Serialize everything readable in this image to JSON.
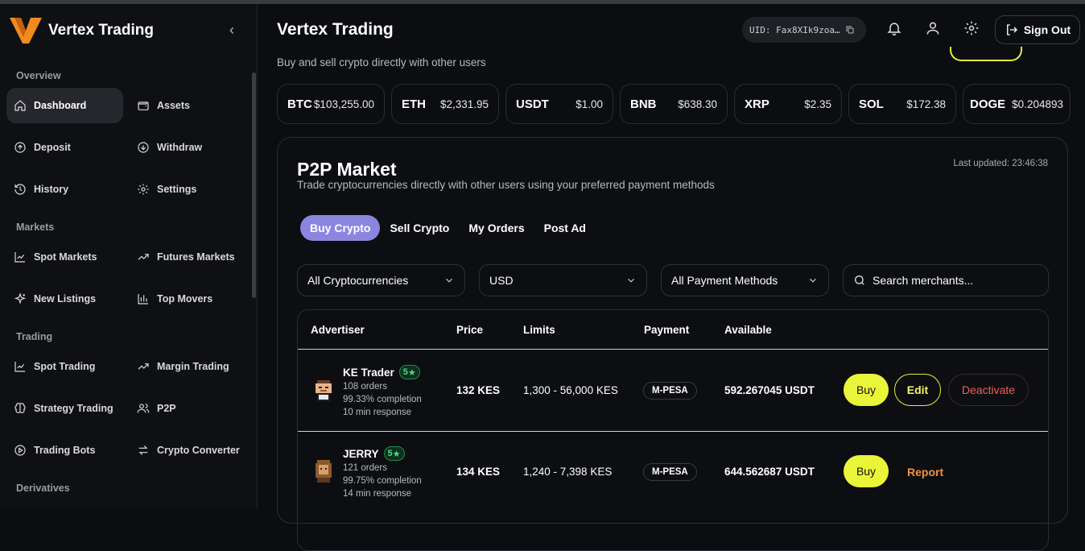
{
  "brand": {
    "name": "Vertex Trading",
    "accent": "#f28a1e"
  },
  "sidebar": {
    "sections": {
      "overview": "Overview",
      "markets": "Markets",
      "trading": "Trading",
      "derivatives": "Derivatives"
    },
    "items": {
      "dashboard": "Dashboard",
      "assets": "Assets",
      "deposit": "Deposit",
      "withdraw": "Withdraw",
      "history": "History",
      "settings": "Settings",
      "spot_markets": "Spot Markets",
      "futures_markets": "Futures Markets",
      "new_listings": "New Listings",
      "top_movers": "Top Movers",
      "spot_trading": "Spot Trading",
      "margin_trading": "Margin Trading",
      "strategy_trading": "Strategy Trading",
      "p2p": "P2P",
      "trading_bots": "Trading Bots",
      "crypto_converter": "Crypto Converter"
    }
  },
  "header": {
    "title": "Vertex Trading",
    "uid": "UID: Fax8XIk9zoa…",
    "sign_out": "Sign Out"
  },
  "main": {
    "subtitle": "Buy and sell crypto directly with other users",
    "tickers": [
      {
        "symbol": "BTC",
        "price": "$103,255.00"
      },
      {
        "symbol": "ETH",
        "price": "$2,331.95"
      },
      {
        "symbol": "USDT",
        "price": "$1.00"
      },
      {
        "symbol": "BNB",
        "price": "$638.30"
      },
      {
        "symbol": "XRP",
        "price": "$2.35"
      },
      {
        "symbol": "SOL",
        "price": "$172.38"
      },
      {
        "symbol": "DOGE",
        "price": "$0.204893"
      }
    ]
  },
  "p2p": {
    "title": "P2P Market",
    "subtitle": "Trade cryptocurrencies directly with other users using your preferred payment methods",
    "last_updated": "Last updated: 23:46:38",
    "tabs": [
      "Buy Crypto",
      "Sell Crypto",
      "My Orders",
      "Post Ad"
    ],
    "filters": {
      "crypto": "All Cryptocurrencies",
      "currency": "USD",
      "payment": "All Payment Methods",
      "search_placeholder": "Search merchants..."
    },
    "columns": [
      "Advertiser",
      "Price",
      "Limits",
      "Payment",
      "Available"
    ],
    "rows": [
      {
        "name": "KE Trader",
        "rating": "5",
        "orders": "108 orders",
        "completion": "99.33% completion",
        "response": "10 min response",
        "price": "132 KES",
        "limits": "1,300 - 56,000 KES",
        "payment": "M-PESA",
        "available": "592.267045 USDT",
        "buy": "Buy",
        "edit": "Edit",
        "deactivate": "Deactivate"
      },
      {
        "name": "JERRY",
        "rating": "5",
        "orders": "121 orders",
        "completion": "99.75% completion",
        "response": "14 min response",
        "price": "134 KES",
        "limits": "1,240 - 7,398 KES",
        "payment": "M-PESA",
        "available": "644.562687 USDT",
        "buy": "Buy",
        "report": "Report"
      }
    ]
  }
}
